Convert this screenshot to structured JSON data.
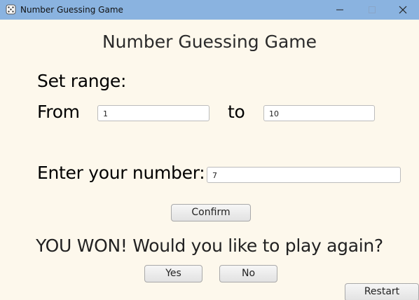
{
  "window": {
    "title": "Number Guessing Game",
    "icon": "dice-icon",
    "controls": [
      "minimize-icon",
      "maximize-icon",
      "close-icon"
    ],
    "titlebar_color": "#8ab3e0"
  },
  "heading": "Number Guessing Game",
  "range": {
    "label": "Set range:",
    "from_label": "From",
    "from_value": "1",
    "to_label": "to",
    "to_value": "10"
  },
  "guess": {
    "label": "Enter your number:",
    "value": "7"
  },
  "buttons": {
    "confirm": "Confirm",
    "yes": "Yes",
    "no": "No",
    "restart": "Restart"
  },
  "result_message": "YOU WON!  Would you like to play again?"
}
